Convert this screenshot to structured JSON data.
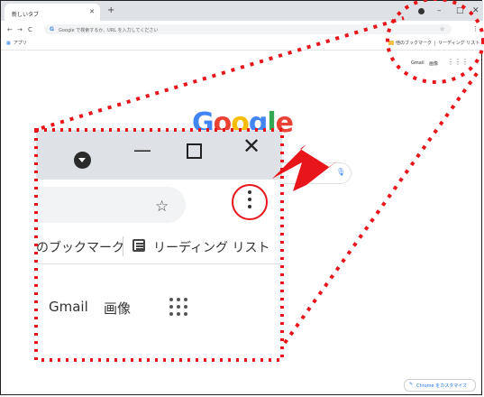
{
  "browser": {
    "tab_title": "新しいタブ",
    "tab_close_icon": "close-icon",
    "new_tab_icon": "plus-icon",
    "window_controls": [
      "–",
      "□",
      "×"
    ],
    "omnibox_placeholder": "Google で検索するか、URL を入力してください",
    "bookmarks_bar": {
      "apps_label": "アプリ",
      "other_bookmarks_label": "他のブックマーク",
      "reading_list_label": "リーディング リスト"
    }
  },
  "google_page": {
    "logo_text": "Google",
    "logo_colors": [
      "#4285f4",
      "#ea4335",
      "#fbbc05",
      "#4285f4",
      "#34a853",
      "#ea4335"
    ],
    "gmail_label": "Gmail",
    "images_label": "画像",
    "customize_label": "Chrome をカスタマイズ"
  },
  "zoom_callout": {
    "bookmark_text": "のブックマーク",
    "reading_list_text": "リーディング リスト",
    "gmail_label": "Gmail",
    "images_label": "画像",
    "highlight_color": "#e8151b",
    "dotted_frame_color": "#e8151b",
    "highlighted_control": "three-dot-menu-icon"
  }
}
